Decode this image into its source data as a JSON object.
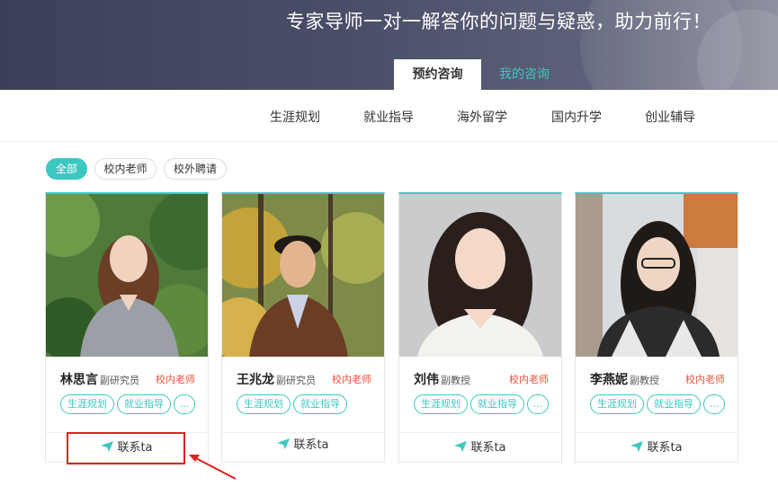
{
  "banner": {
    "title": "专家导师一对一解答你的问题与疑惑，助力前行！",
    "tabs": [
      {
        "label": "预约咨询",
        "active": true
      },
      {
        "label": "我的咨询",
        "active": false
      }
    ]
  },
  "categories": [
    "生涯规划",
    "就业指导",
    "海外留学",
    "国内升学",
    "创业辅导"
  ],
  "filters": [
    {
      "label": "全部",
      "active": true
    },
    {
      "label": "校内老师",
      "active": false
    },
    {
      "label": "校外聘请",
      "active": false
    }
  ],
  "mentors": [
    {
      "name": "林思言",
      "title": "副研究员",
      "badge": "校内老师",
      "tags": [
        "生涯规划",
        "就业指导"
      ],
      "more": "...",
      "contact": "联系ta"
    },
    {
      "name": "王兆龙",
      "title": "副研究员",
      "badge": "校内老师",
      "tags": [
        "生涯规划",
        "就业指导"
      ],
      "contact": "联系ta"
    },
    {
      "name": "刘伟",
      "title": "副教授",
      "badge": "校内老师",
      "tags": [
        "生涯规划",
        "就业指导"
      ],
      "more": "...",
      "contact": "联系ta"
    },
    {
      "name": "李燕妮",
      "title": "副教授",
      "badge": "校内老师",
      "tags": [
        "生涯规划",
        "就业指导"
      ],
      "more": "...",
      "contact": "联系ta"
    }
  ],
  "colors": {
    "accent": "#3cc8c0",
    "badge": "#e8503a",
    "annotation": "#e02020"
  }
}
